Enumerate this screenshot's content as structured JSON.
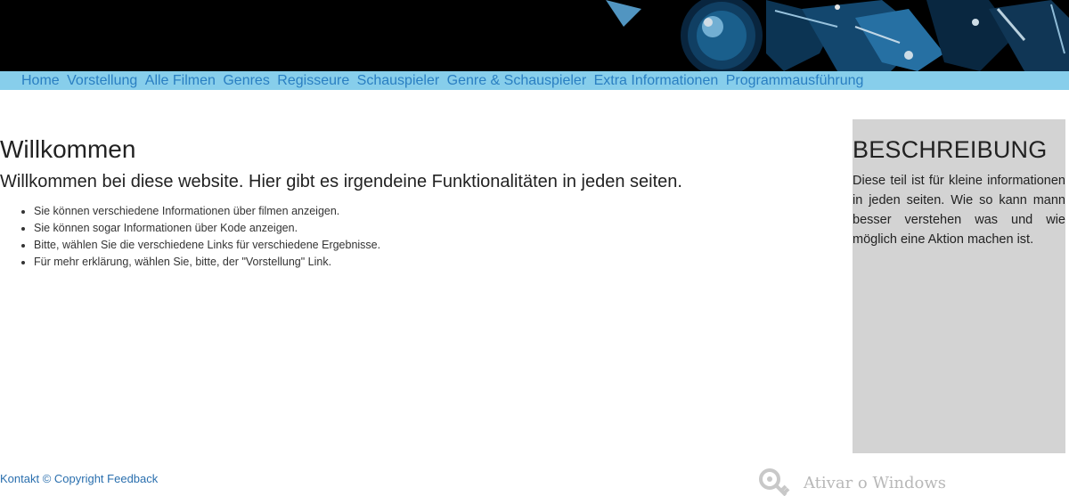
{
  "nav": {
    "items": [
      "Home",
      "Vorstellung",
      "Alle Filmen",
      "Genres",
      "Regisseure",
      "Schauspieler",
      "Genre & Schauspieler",
      "Extra Informationen",
      "Programmausführung"
    ]
  },
  "main": {
    "title": "Willkommen",
    "subtitle": "Willkommen bei diese website. Hier gibt es irgendeine Funktionalitäten in jeden seiten.",
    "list": [
      "Sie können verschiedene Informationen über filmen anzeigen.",
      "Sie können sogar Informationen über Kode anzeigen.",
      "Bitte, wählen Sie die verschiedene Links für verschiedene Ergebnisse.",
      "Für mehr erklärung, wählen Sie, bitte, der \"Vorstellung\" Link."
    ]
  },
  "aside": {
    "title": "BESCHREIBUNG",
    "text": "Diese teil ist für kleine informationen in jeden seiten. Wie so kann mann besser verstehen was und wie möglich eine Aktion machen ist."
  },
  "footer": {
    "contact": "Kontakt",
    "copyright": "© Copyright",
    "feedback": "Feedback"
  },
  "watermark": {
    "text": "Ativar o Windows",
    "icon": "key-icon"
  },
  "colors": {
    "nav_background": "#87ceeb",
    "nav_link": "#2a7fc2",
    "aside_background": "#d3d3d3",
    "footer_link": "#2a6fae"
  }
}
